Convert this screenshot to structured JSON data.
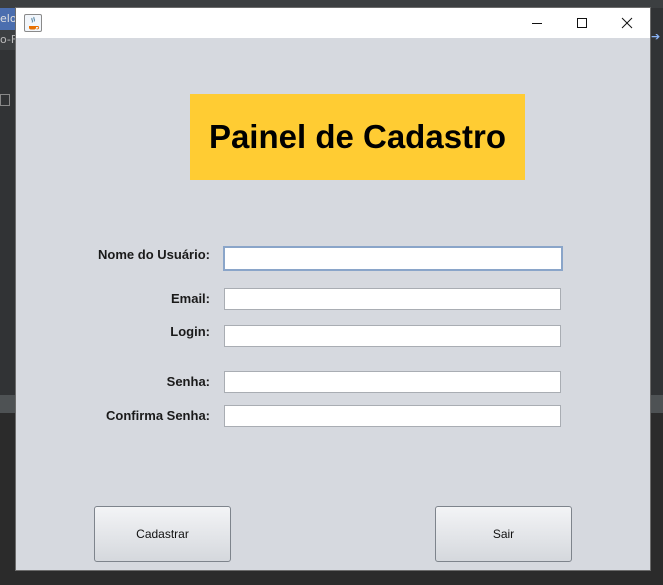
{
  "window": {
    "title": "",
    "controls": {
      "minimize_icon": "minimize-icon",
      "maximize_icon": "maximize-icon",
      "close_icon": "close-icon"
    }
  },
  "header": {
    "title": "Painel de Cadastro",
    "background_color": "#ffcc33"
  },
  "form": {
    "fields": [
      {
        "label": "Nome do Usuário:",
        "value": ""
      },
      {
        "label": "Email:",
        "value": ""
      },
      {
        "label": "Login:",
        "value": ""
      },
      {
        "label": "Senha:",
        "value": ""
      },
      {
        "label": "Confirma Senha:",
        "value": ""
      }
    ]
  },
  "buttons": {
    "cadastrar": "Cadastrar",
    "sair": "Sair"
  },
  "background": {
    "tab_text": "elo",
    "tab2_text": "o-F"
  }
}
